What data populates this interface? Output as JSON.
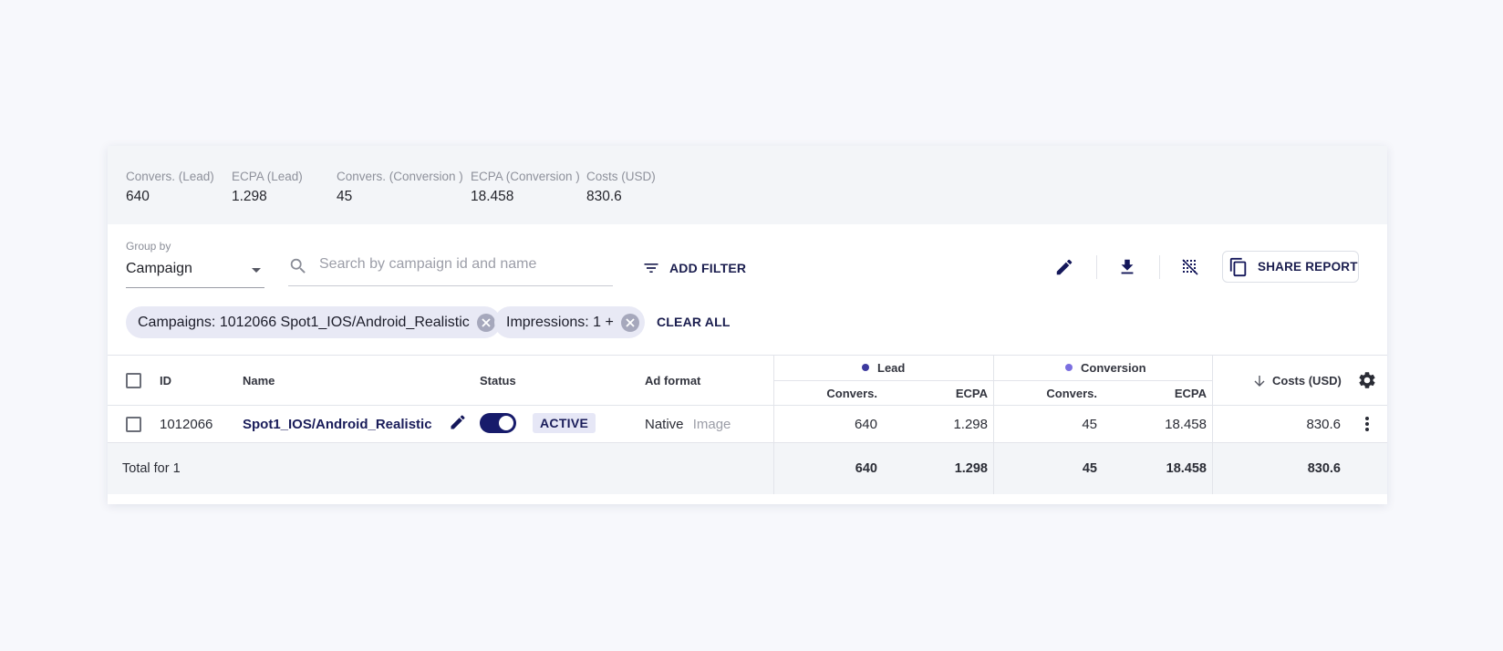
{
  "summary": {
    "metrics": [
      {
        "label": "Convers. (Lead)",
        "value": "640"
      },
      {
        "label": "ECPA (Lead)",
        "value": "1.298"
      },
      {
        "label": "Convers. (Conversion )",
        "value": "45"
      },
      {
        "label": "ECPA (Conversion )",
        "value": "18.458"
      },
      {
        "label": "Costs (USD)",
        "value": "830.6"
      }
    ]
  },
  "toolbar": {
    "group_by_label": "Group by",
    "group_by_value": "Campaign",
    "search_placeholder": "Search by campaign id and name",
    "search_value": "",
    "add_filter_label": "ADD FILTER",
    "share_report_label": "SHARE REPORT"
  },
  "filters": {
    "chips": [
      {
        "label": "Campaigns: 1012066 Spot1_IOS/Android_Realistic"
      },
      {
        "label": "Impressions: 1 +"
      }
    ],
    "clear_all_label": "CLEAR ALL"
  },
  "table": {
    "headers": {
      "id": "ID",
      "name": "Name",
      "status": "Status",
      "ad_format": "Ad format",
      "group_lead": "Lead",
      "group_conversion": "Conversion",
      "convers": "Convers.",
      "ecpa": "ECPA",
      "costs": "Costs (USD)"
    },
    "group_colors": {
      "lead": "#3d3a9e",
      "conversion": "#7b6fe0"
    },
    "rows": [
      {
        "id": "1012066",
        "name": "Spot1_IOS/Android_Realistic",
        "status": "ACTIVE",
        "status_on": true,
        "ad_format_primary": "Native",
        "ad_format_secondary": "Image",
        "lead_convers": "640",
        "lead_ecpa": "1.298",
        "conv_convers": "45",
        "conv_ecpa": "18.458",
        "costs": "830.6"
      }
    ],
    "total": {
      "label": "Total for 1",
      "lead_convers": "640",
      "lead_ecpa": "1.298",
      "conv_convers": "45",
      "conv_ecpa": "18.458",
      "costs": "830.6"
    }
  },
  "colors": {
    "accent": "#171b6b",
    "link": "#1a1d5a"
  }
}
